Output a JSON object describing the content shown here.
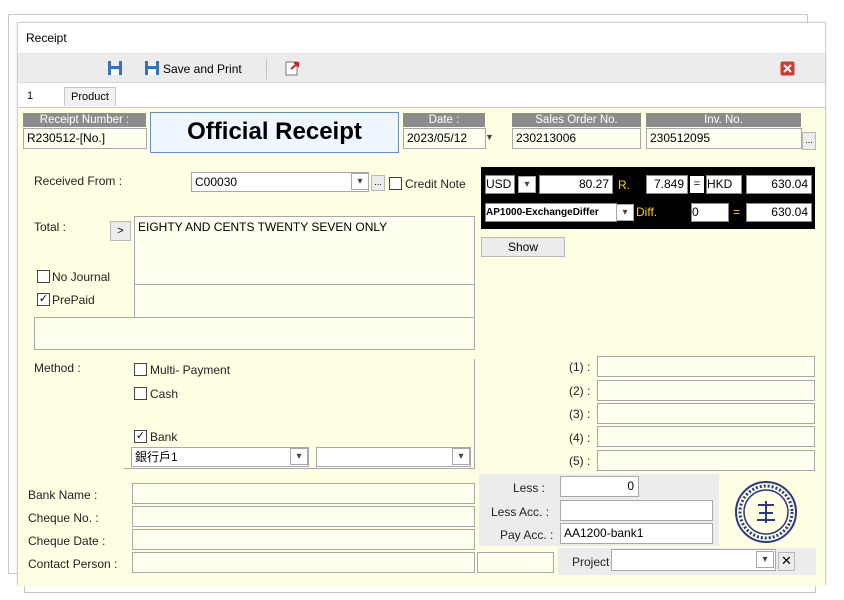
{
  "window": {
    "title": "Receipt"
  },
  "toolbar": {
    "save_icon": "floppy-disk-icon",
    "save_print_label": "Save and Print",
    "export_icon": "export-icon",
    "close_icon": "close-icon"
  },
  "tabs": {
    "index": "1",
    "product": "Product"
  },
  "header": {
    "receipt_number_label": "Receipt Number :",
    "receipt_number_value": "R230512-[No.]",
    "title": "Official Receipt",
    "date_label": "Date :",
    "date_value": "2023/05/12",
    "sales_order_label": "Sales Order No.",
    "sales_order_value": "230213006",
    "inv_no_label": "Inv. No.",
    "inv_no_value": "230512095",
    "ellipsis": "..."
  },
  "received": {
    "label": "Received From :",
    "value": "C00030",
    "ellipsis": "...",
    "credit_note_label": "Credit Note",
    "credit_note_checked": false
  },
  "currency": {
    "code": "USD",
    "amount": "80.27",
    "rate_label": "R.",
    "rate": "7.849",
    "equals": "=",
    "base_code": "HKD",
    "base_amount": "630.04",
    "diff_account": "AP1000-ExchangeDiffer",
    "diff_label": "Diff.",
    "diff_value": "0",
    "diff_total": "630.04"
  },
  "total": {
    "label": "Total :",
    "arrow": ">",
    "words": "EIGHTY AND CENTS TWENTY SEVEN ONLY",
    "show_button": "Show"
  },
  "flags": {
    "no_journal_label": "No Journal",
    "no_journal_checked": false,
    "prepaid_label": "PrePaid",
    "prepaid_checked": true
  },
  "method": {
    "label": "Method :",
    "multi_payment_label": "Multi- Payment",
    "cash_label": "Cash",
    "bank_label": "Bank",
    "bank_account": "銀行戶1",
    "bank_checked": true,
    "lines": [
      "(1) :",
      "(2) :",
      "(3) :",
      "(4) :",
      "(5) :"
    ]
  },
  "bank": {
    "bank_name_label": "Bank Name :",
    "cheque_no_label": "Cheque No. :",
    "cheque_date_label": "Cheque Date :",
    "contact_person_label": "Contact Person :"
  },
  "less": {
    "less_label": "Less :",
    "less_value": "0",
    "less_acc_label": "Less Acc. :",
    "pay_acc_label": "Pay Acc. :",
    "pay_acc_value": "AA1200-bank1",
    "project_label": "Project",
    "clear_icon": "x-icon"
  },
  "stamp": {
    "icon": "company-seal-icon"
  }
}
